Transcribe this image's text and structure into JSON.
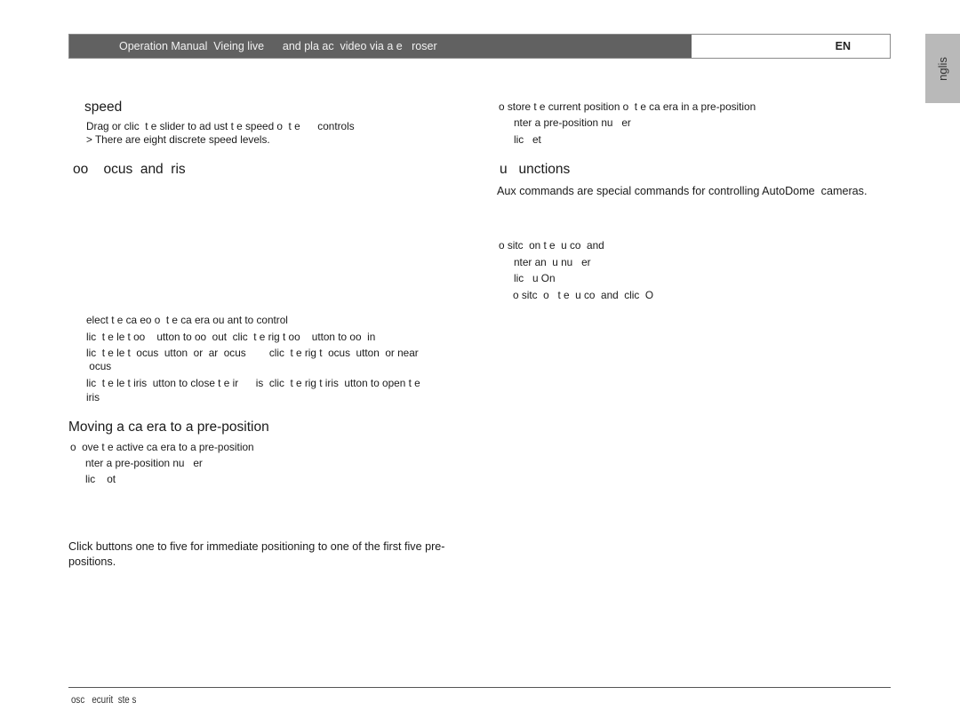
{
  "header": {
    "title": "Operation Manual  Vieing live      and pla ac  video via a e   roser",
    "language_code": "EN"
  },
  "side_tab": {
    "label": "nglis"
  },
  "left_column": {
    "speed_section": {
      "heading": "speed",
      "lines": [
        "Drag or clic  t e slider to ad ust t e speed o  t e      controls",
        "> There are eight discrete speed levels."
      ]
    },
    "zoom_focus_iris_section": {
      "heading": "oo    ocus  and  ris",
      "steps": [
        "elect t e ca eo o  t e ca era ou ant to control",
        "lic  t e le t oo    utton to oo  out  clic  t e rig t oo    utton to oo  in",
        "lic  t e le t  ocus  utton  or  ar  ocus        clic  t e rig t  ocus  utton  or near",
        " ocus",
        "lic  t e le t iris  utton to close t e ir      is  clic  t e rig t iris  utton to open t e",
        "iris"
      ]
    },
    "preposition_section": {
      "heading": "Moving a ca era to a pre-position",
      "intro": "o  ove t e active ca era to a pre-position",
      "steps": [
        "nter a pre-position nu   er",
        "lic    ot"
      ],
      "note_lines": [
        "Click buttons one to five for immediate positioning to one of the first five pre-",
        "positions."
      ]
    }
  },
  "right_column": {
    "store_section": {
      "intro": "o store t e current position o  t e ca era in a pre-position",
      "steps": [
        "nter a pre-position nu   er",
        "lic   et"
      ]
    },
    "aux_section": {
      "heading": "u   unctions",
      "description": "Aux commands are special commands for controlling AutoDome  cameras.",
      "intro": "o sitc  on t e  u co  and",
      "steps": [
        "nter an  u nu   er",
        "lic   u On",
        "o sitc  o   t e  u co  and  clic  O"
      ]
    }
  },
  "footer": {
    "text": "osc   ecurit  ste s"
  }
}
